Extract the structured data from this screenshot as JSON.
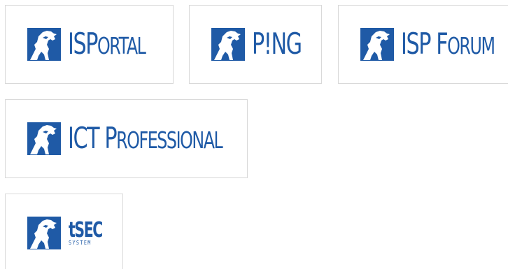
{
  "brand": {
    "primary_color": "#1f5aa6",
    "icon": "lion-emblem-icon"
  },
  "cards": {
    "isportal": {
      "parts": [
        "IS",
        "P",
        "ORTAL"
      ]
    },
    "ping": {
      "parts": [
        "P",
        "!",
        "NG"
      ]
    },
    "ispforum": {
      "parts": [
        "ISP ",
        "F",
        "ORUM"
      ]
    },
    "ictpro": {
      "parts": [
        "ICT ",
        "P",
        "ROFESSIONAL"
      ]
    },
    "tsec": {
      "main": "tSEC",
      "sub": "SYSTEM"
    }
  }
}
